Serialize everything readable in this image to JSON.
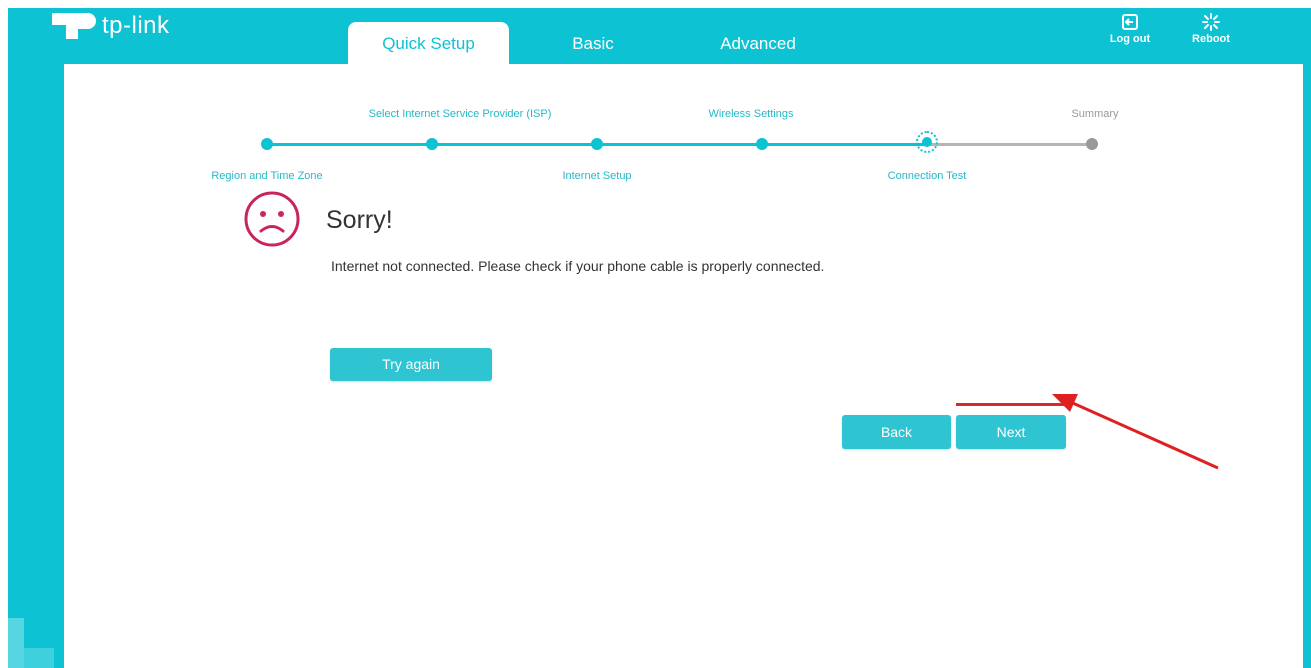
{
  "brand": {
    "logo_text": "tp-link"
  },
  "tabs": [
    {
      "label": "Quick Setup",
      "active": true
    },
    {
      "label": "Basic",
      "active": false
    },
    {
      "label": "Advanced",
      "active": false
    }
  ],
  "top_actions": {
    "logout": {
      "label": "Log out",
      "icon": "logout-icon"
    },
    "reboot": {
      "label": "Reboot",
      "icon": "reboot-icon"
    }
  },
  "stepper": {
    "steps": [
      {
        "label": "Region and Time Zone",
        "state": "done"
      },
      {
        "label": "Select Internet Service Provider (ISP)",
        "state": "done"
      },
      {
        "label": "Internet Setup",
        "state": "done"
      },
      {
        "label": "Wireless Settings",
        "state": "done"
      },
      {
        "label": "Connection Test",
        "state": "current"
      },
      {
        "label": "Summary",
        "state": "pending"
      }
    ]
  },
  "result": {
    "icon": "sad-face-icon",
    "title": "Sorry!",
    "message": "Internet not connected. Please check if your phone cable is properly connected.",
    "try_again_label": "Try again"
  },
  "nav": {
    "back_label": "Back",
    "next_label": "Next"
  },
  "colors": {
    "accent": "#0dc2d3",
    "sad_face": "#c8265a",
    "annotation": "#e02020"
  }
}
